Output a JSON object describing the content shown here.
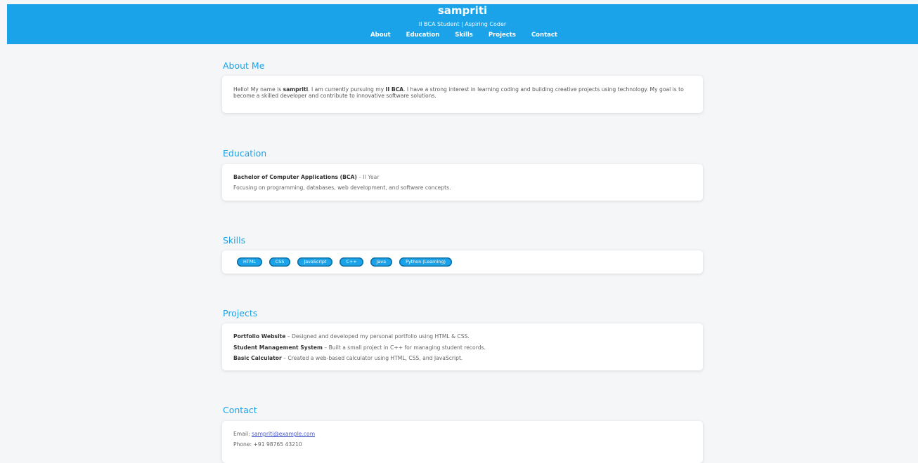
{
  "header": {
    "name": "sampriti",
    "tagline": "II BCA Student | Aspiring Coder",
    "nav": [
      "About",
      "Education",
      "Skills",
      "Projects",
      "Contact"
    ]
  },
  "about": {
    "title": "About Me",
    "text_1": "Hello! My name is ",
    "name": "sampriti",
    "text_2": ". I am currently pursuing my ",
    "course": "II BCA",
    "text_3": ". I have a strong interest in learning coding and building creative projects using technology. My goal is to become a skilled developer and contribute to innovative software solutions."
  },
  "education": {
    "title": "Education",
    "degree": "Bachelor of Computer Applications (BCA)",
    "year": " – II Year",
    "description": "Focusing on programming, databases, web development, and software concepts."
  },
  "skills": {
    "title": "Skills",
    "items": [
      "HTML",
      "CSS",
      "JavaScript",
      "C++",
      "Java",
      "Python (Learning)"
    ]
  },
  "projects": {
    "title": "Projects",
    "items": [
      {
        "name": "Portfolio Website",
        "desc": " – Designed and developed my personal portfolio using HTML & CSS."
      },
      {
        "name": "Student Management System",
        "desc": " – Built a small project in C++ for managing student records."
      },
      {
        "name": "Basic Calculator",
        "desc": " – Created a web-based calculator using HTML, CSS, and JavaScript."
      }
    ]
  },
  "contact": {
    "title": "Contact",
    "email_label": "Email: ",
    "email": "sampriti@example.com",
    "phone_label": "Phone: ",
    "phone": "+91 98765 43210"
  }
}
